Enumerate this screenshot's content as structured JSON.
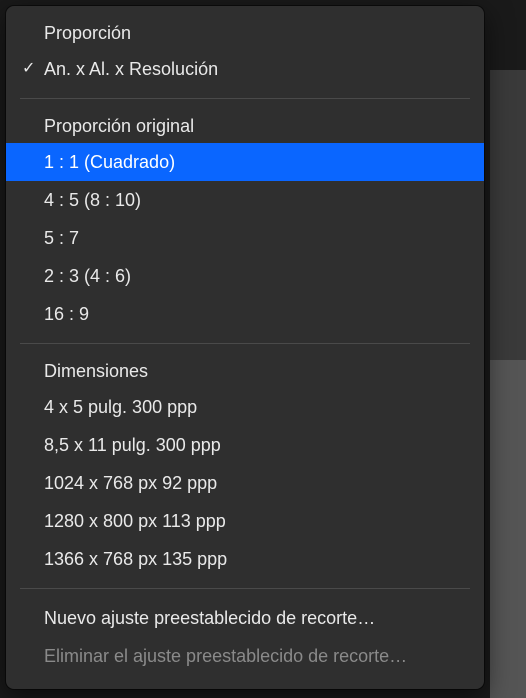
{
  "section1": {
    "heading": "Proporción",
    "current": "An. x Al. x Resolución"
  },
  "ratios": {
    "heading": "Proporción original",
    "items": [
      "1 : 1 (Cuadrado)",
      "4 : 5 (8 : 10)",
      "5 : 7",
      "2 : 3 (4 : 6)",
      "16 : 9"
    ]
  },
  "dimensions": {
    "heading": "Dimensiones",
    "items": [
      "4 x 5 pulg.  300 ppp",
      "8,5 x 11 pulg.  300 ppp",
      "1024 x 768 px  92 ppp",
      "1280 x 800 px  113 ppp",
      "1366 x 768 px  135 ppp"
    ]
  },
  "footer": {
    "new_preset": "Nuevo ajuste preestablecido de recorte…",
    "delete_preset": "Eliminar el ajuste preestablecido de recorte…"
  }
}
